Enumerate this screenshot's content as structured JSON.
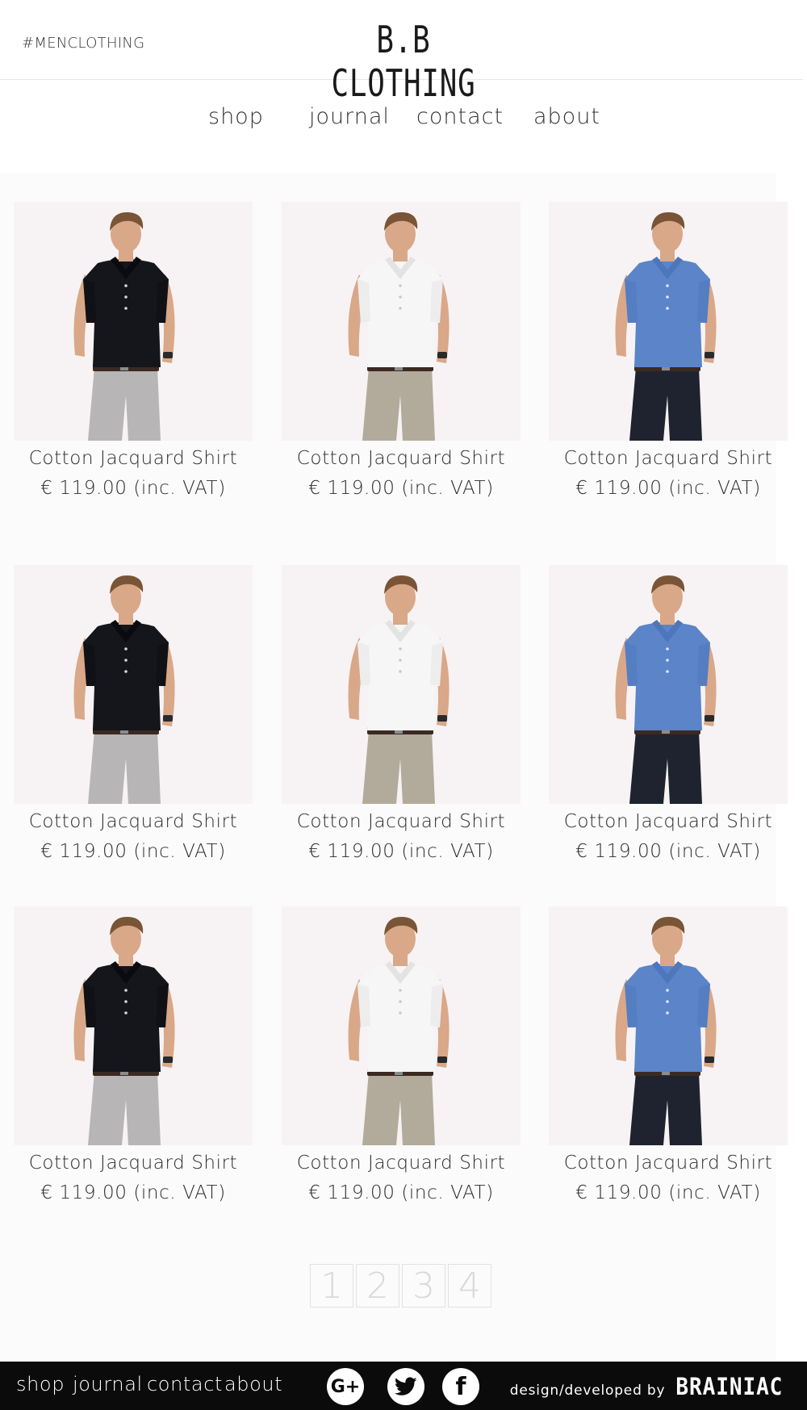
{
  "header": {
    "hashtag": "#MENCLOTHING",
    "logo": "B.B CLOTHING"
  },
  "nav": {
    "items": [
      "shop",
      "journal",
      "contact",
      "about"
    ]
  },
  "products": [
    {
      "name": "Cotton Jacquard Shirt",
      "price": "€ 119.00 (inc. VAT)",
      "shirt": "black polo"
    },
    {
      "name": "Cotton Jacquard Shirt",
      "price": "€ 119.00 (inc. VAT)",
      "shirt": "white polo"
    },
    {
      "name": "Cotton Jacquard Shirt",
      "price": "€ 119.00 (inc. VAT)",
      "shirt": "blue shirt"
    },
    {
      "name": "Cotton Jacquard Shirt",
      "price": "€ 119.00 (inc. VAT)",
      "shirt": "black polo"
    },
    {
      "name": "Cotton Jacquard Shirt",
      "price": "€ 119.00 (inc. VAT)",
      "shirt": "white polo"
    },
    {
      "name": "Cotton Jacquard Shirt",
      "price": "€ 119.00 (inc. VAT)",
      "shirt": "blue shirt"
    },
    {
      "name": "Cotton Jacquard Shirt",
      "price": "€ 119.00 (inc. VAT)",
      "shirt": "black polo"
    },
    {
      "name": "Cotton Jacquard Shirt",
      "price": "€ 119.00 (inc. VAT)",
      "shirt": "white polo"
    },
    {
      "name": "Cotton Jacquard Shirt",
      "price": "€ 119.00 (inc. VAT)",
      "shirt": "blue shirt"
    }
  ],
  "pagination": {
    "pages": [
      "1",
      "2",
      "3",
      "4"
    ]
  },
  "footer": {
    "links": [
      "shop",
      "journal",
      "contact",
      "about"
    ],
    "social": [
      {
        "icon": "google-plus-icon",
        "glyph": "G+"
      },
      {
        "icon": "twitter-icon",
        "glyph": "🐦"
      },
      {
        "icon": "facebook-icon",
        "glyph": "f"
      }
    ],
    "credit_text": "design/developed by",
    "credit_brand": "BRAINIAC"
  },
  "colors": {
    "page_bg": "#ffffff",
    "panel_bg": "#fcfbfb",
    "photo_bg": "#f7f3f4",
    "footer_bg": "#0b0b0b",
    "shirt_black": "#14161c",
    "shirt_white": "#f6f6f6",
    "shirt_blue": "#5b84c9",
    "pants_grey": "#b7b5b6",
    "pants_khaki": "#b2aa9b",
    "pants_denim": "#1f2330"
  }
}
